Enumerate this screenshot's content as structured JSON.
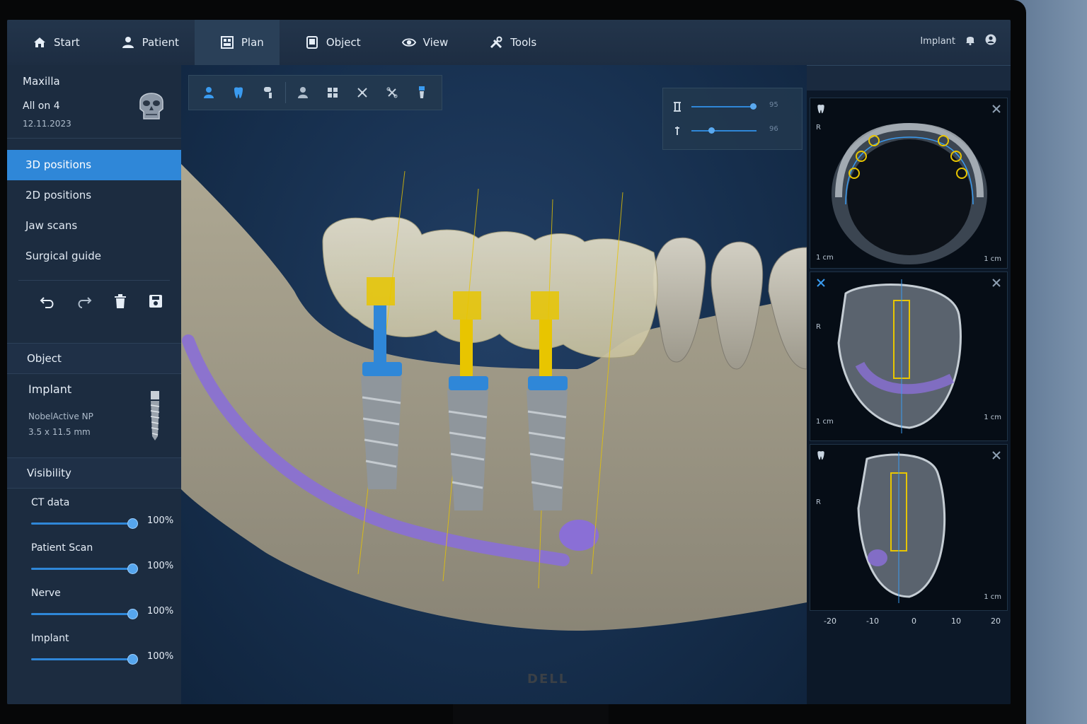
{
  "brand": "DELL",
  "topbar": {
    "tabs": [
      {
        "label": "Start",
        "icon": "home-icon"
      },
      {
        "label": "Patient",
        "icon": "user-icon"
      },
      {
        "label": "Plan",
        "icon": "plan-icon"
      },
      {
        "label": "Object",
        "icon": "object-icon"
      },
      {
        "label": "View",
        "icon": "eye-icon"
      },
      {
        "label": "Tools",
        "icon": "tools-icon"
      }
    ],
    "active_tab": "Plan",
    "right_label": "Implant"
  },
  "sidebar": {
    "case": {
      "jaw": "Maxilla",
      "plan": "All on 4",
      "date": "12.11.2023"
    },
    "nav": [
      "3D positions",
      "2D positions",
      "Jaw scans",
      "Surgical guide"
    ],
    "active_nav": "3D positions",
    "object": {
      "header": "Object",
      "name": "Implant",
      "model": "NobelActive NP",
      "size": "3.5 x 11.5 mm"
    },
    "visibility": {
      "header": "Visibility",
      "items": [
        {
          "label": "CT data",
          "value": "100%"
        },
        {
          "label": "Patient Scan",
          "value": "100%"
        },
        {
          "label": "Nerve",
          "value": "100%"
        },
        {
          "label": "Implant",
          "value": "100%"
        }
      ]
    }
  },
  "viewport": {
    "sliders": [
      {
        "value_label": "95",
        "level": 0.95
      },
      {
        "value_label": "96",
        "level": 0.3
      }
    ],
    "colors": {
      "nerve": "#8a6fd6",
      "implant_yellow": "#e8c500",
      "implant_blue": "#2f87d8",
      "bone": "#a39d8c"
    }
  },
  "side_views": {
    "axial": {
      "orient": "R",
      "scale": "1 cm",
      "scale2": "1 cm"
    },
    "cross1": {
      "orient": "R",
      "scale": "1 cm",
      "scale2": "1 cm"
    },
    "cross2": {
      "orient": "R",
      "scale2": "1 cm"
    },
    "axis_ticks": [
      "-20",
      "-10",
      "0",
      "10",
      "20"
    ]
  }
}
